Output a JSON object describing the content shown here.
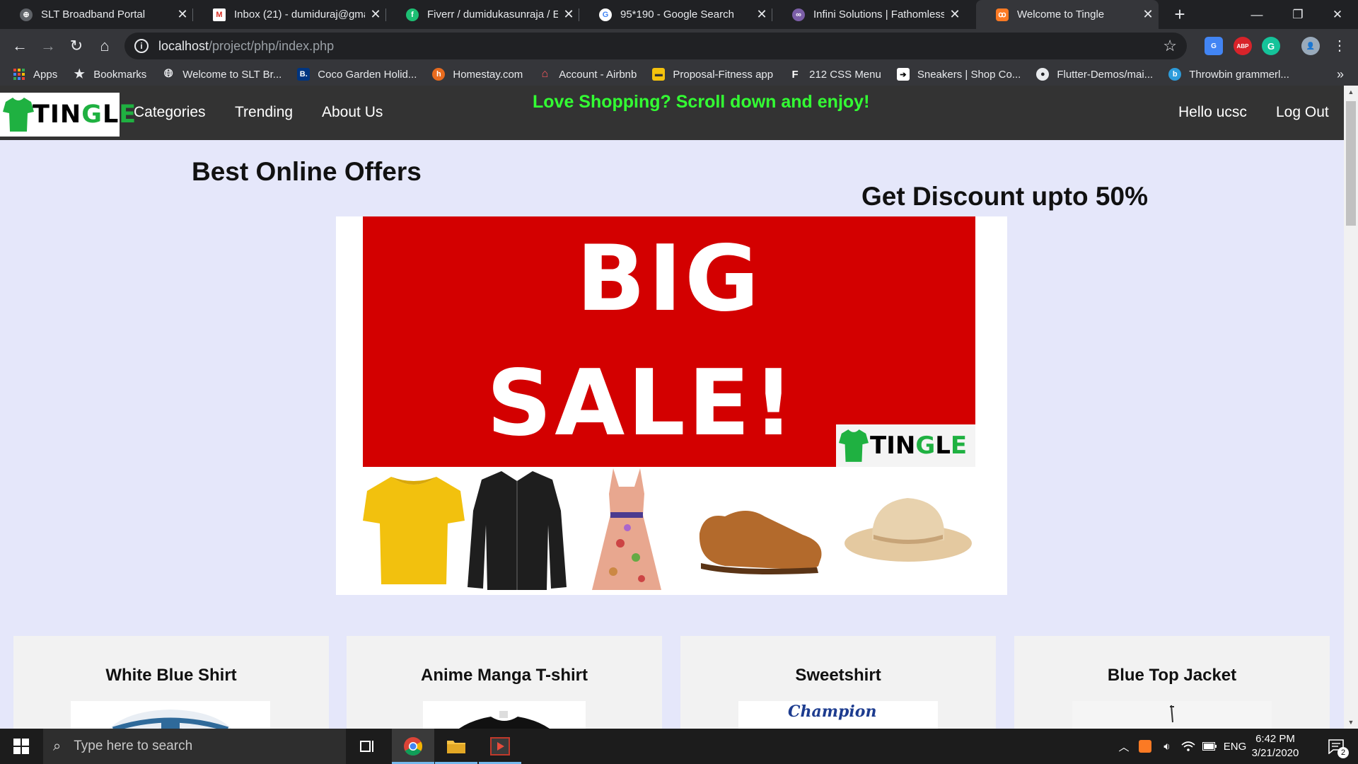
{
  "browser": {
    "tabs": [
      {
        "title": "SLT Broadband Portal",
        "icon": "globe-icon",
        "active": false
      },
      {
        "title": "Inbox (21) - dumiduraj@gma",
        "icon": "gmail-icon",
        "active": false
      },
      {
        "title": "Fiverr / dumidukasunraja / Ed",
        "icon": "fiverr-icon",
        "active": false
      },
      {
        "title": "95*190 - Google Search",
        "icon": "google-icon",
        "active": false
      },
      {
        "title": "Infini Solutions | Fathomless I",
        "icon": "infini-icon",
        "active": false
      },
      {
        "title": "Welcome to Tingle",
        "icon": "xampp-icon",
        "active": true
      }
    ],
    "address": {
      "host": "localhost",
      "path": "/project/php/index.php"
    },
    "bookmarks": [
      {
        "label": "Apps",
        "icon": "apps-grid-icon"
      },
      {
        "label": "Bookmarks",
        "icon": "star-icon"
      },
      {
        "label": "Welcome to SLT Br...",
        "icon": "globe-icon"
      },
      {
        "label": "Coco Garden Holid...",
        "icon": "booking-icon"
      },
      {
        "label": "Homestay.com",
        "icon": "homestay-icon"
      },
      {
        "label": "Account - Airbnb",
        "icon": "airbnb-icon"
      },
      {
        "label": "Proposal-Fitness app",
        "icon": "folder-icon"
      },
      {
        "label": "212 CSS Menu",
        "icon": "f-letter-icon"
      },
      {
        "label": "Sneakers | Shop Co...",
        "icon": "sneakers-icon"
      },
      {
        "label": "Flutter-Demos/mai...",
        "icon": "github-icon"
      },
      {
        "label": "Throwbin grammerl...",
        "icon": "throwbin-icon"
      }
    ]
  },
  "site": {
    "logo": {
      "t": "T",
      "i": "I",
      "n": "N",
      "g": "G",
      "l": "L",
      "e": "E"
    },
    "nav": {
      "categories": "Categories",
      "trending": "Trending",
      "about": "About Us"
    },
    "tagline": "Love Shopping? Scroll down and enjoy!",
    "user": {
      "greeting": "Hello ucsc",
      "logout": "Log Out"
    },
    "offers_heading": "Best Online Offers",
    "discount_heading": "Get Discount upto 50%",
    "banner": {
      "line1": "BIG",
      "line2": "SALE!"
    },
    "products": [
      {
        "title": "White Blue Shirt"
      },
      {
        "title": "Anime Manga T-shirt"
      },
      {
        "title": "Sweetshirt",
        "brand": "Champion"
      },
      {
        "title": "Blue Top Jacket"
      }
    ]
  },
  "taskbar": {
    "search_placeholder": "Type here to search",
    "language": "ENG",
    "time": "6:42 PM",
    "date": "3/21/2020",
    "notification_count": "2"
  }
}
